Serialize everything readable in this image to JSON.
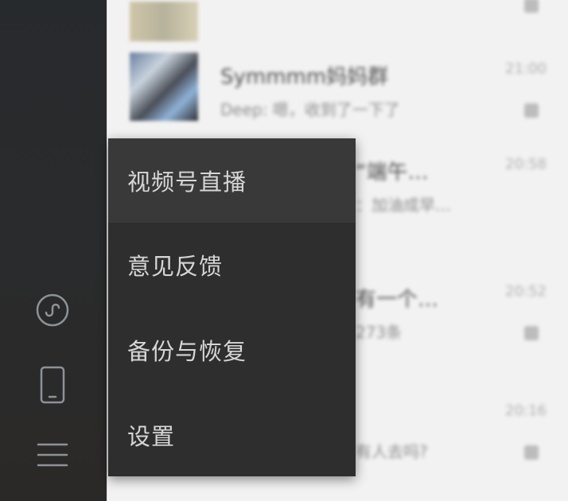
{
  "sidebar": {
    "icons": [
      {
        "name": "mini-program-icon"
      },
      {
        "name": "phone-icon"
      },
      {
        "name": "menu-icon"
      }
    ],
    "icon_color": "#8d9297"
  },
  "menu": {
    "items": [
      {
        "label": "视频号直播"
      },
      {
        "label": "意见反馈"
      },
      {
        "label": "备份与恢复"
      },
      {
        "label": "设置"
      }
    ],
    "background": "#2e2e2e",
    "hover_background": "#393939",
    "text_color": "#d6d6d6"
  },
  "chat_list": {
    "rows": [
      {
        "name": "",
        "preview": "",
        "time": ""
      },
      {
        "name": "Symmmm妈妈群",
        "preview": "Deep: 嗯，收到了一下了",
        "time": "21:00"
      },
      {
        "name": "“端午…",
        "preview": "：加油成早…",
        "time": "20:58"
      },
      {
        "name": "有一个…",
        "preview": "273条",
        "time": "20:52"
      },
      {
        "name": "",
        "preview": "有人去吗?",
        "time": "20:16"
      }
    ]
  }
}
